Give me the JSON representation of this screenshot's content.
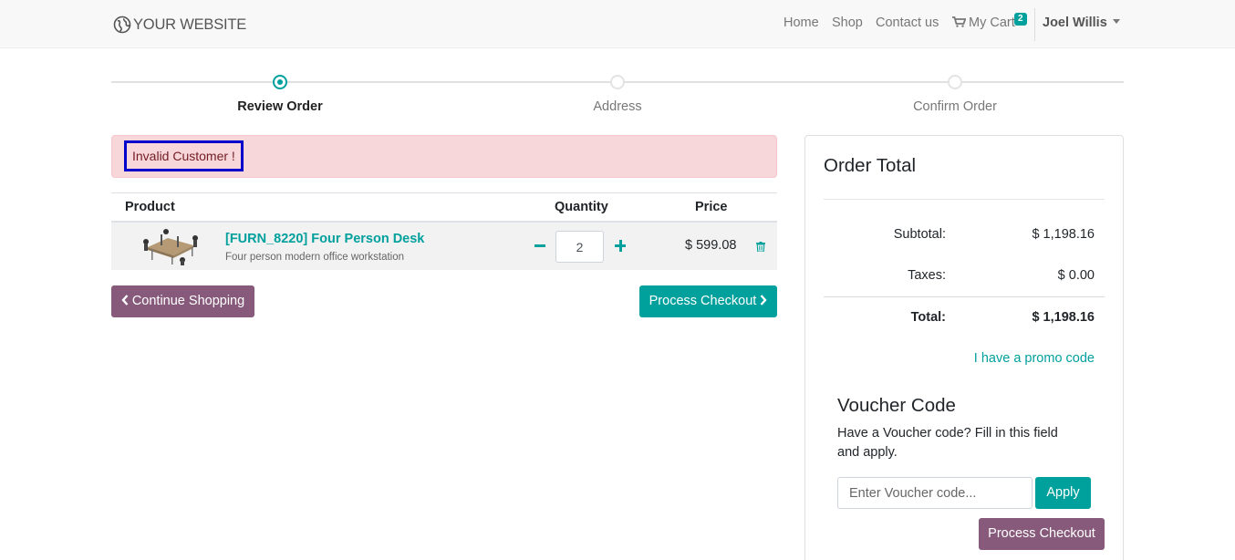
{
  "navbar": {
    "logo_text": "YOUR WEBSITE",
    "links": {
      "home": "Home",
      "shop": "Shop",
      "contact": "Contact us",
      "cart": "My Cart",
      "cart_count": "2"
    },
    "user_name": "Joel Willis"
  },
  "wizard": {
    "steps": [
      {
        "label": "Review Order",
        "state": "active"
      },
      {
        "label": "Address",
        "state": "pending"
      },
      {
        "label": "Confirm Order",
        "state": "pending"
      }
    ]
  },
  "alert": {
    "message": "Invalid Customer !"
  },
  "cart": {
    "headers": {
      "product": "Product",
      "quantity": "Quantity",
      "price": "Price"
    },
    "rows": [
      {
        "name": "[FURN_8220] Four Person Desk",
        "description": "Four person modern office workstation",
        "quantity": "2",
        "price": "$ 599.08"
      }
    ],
    "continue_label": "Continue Shopping",
    "checkout_label": "Process Checkout"
  },
  "order_total": {
    "title": "Order Total",
    "subtotal_label": "Subtotal:",
    "subtotal_value": "$ 1,198.16",
    "taxes_label": "Taxes:",
    "taxes_value": "$ 0.00",
    "total_label": "Total:",
    "total_value": "$ 1,198.16",
    "promo_link": "I have a promo code"
  },
  "voucher": {
    "title": "Voucher Code",
    "description": "Have a Voucher code? Fill in this field and apply.",
    "placeholder": "Enter Voucher code...",
    "apply_label": "Apply",
    "checkout_label": "Process Checkout"
  },
  "colors": {
    "brand_teal": "#00A09D",
    "brand_purple": "#875A7B",
    "alert_bg": "#F8D7DA",
    "alert_text": "#721C24"
  }
}
